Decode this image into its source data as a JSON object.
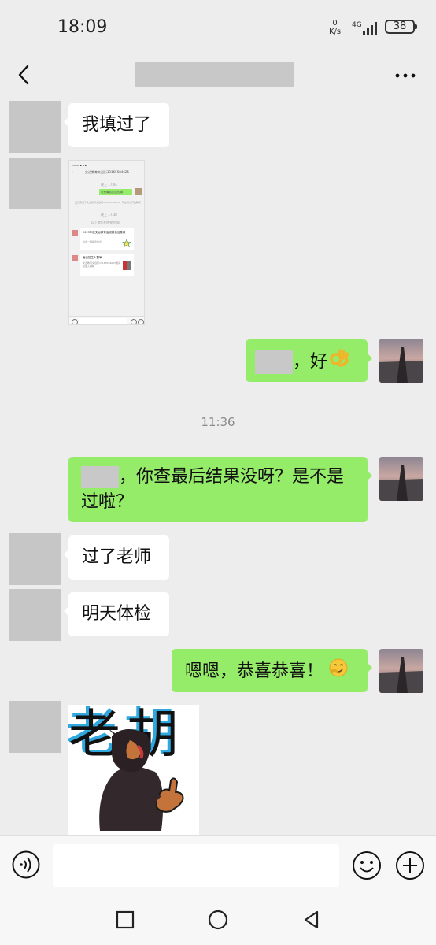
{
  "status_bar": {
    "time": "18:09",
    "net_speed_value": "0",
    "net_speed_unit": "K/s",
    "network": "4G",
    "battery": "38"
  },
  "nav": {
    "back_icon": "chevron-left-icon",
    "more_icon": "more-dots-icon"
  },
  "messages": {
    "m1": {
      "text": "我填过了"
    },
    "m3": {
      "suffix": "，好",
      "emoji": "ok-hand-emoji"
    },
    "timestamp": "11:36",
    "m4": {
      "line1_suffix": "，你查最后结果没呀？是不是",
      "line2": "过啦？"
    },
    "m5": {
      "text": "过了老师"
    },
    "m6": {
      "text": "明天体检"
    },
    "m7": {
      "text": "嗯嗯，恭喜恭喜！",
      "emoji": "smirk-emoji"
    }
  },
  "embedded_screenshot": {
    "header": "文达教育文远衍13165584625",
    "time1": "晚上 17:04",
    "bubble": "老是最后的过的嘛",
    "notice": "您已添加了文达教育文远衍13165584625，现在可以开始聊天了。",
    "time2": "晚上 17:38",
    "tip": "以上是打招呼的内容",
    "card1_title": "2023年度文远教育面试报名信息表",
    "card1_sub": "共享一起填表信息",
    "card2_title": "面谈招生人群审",
    "card2_sub": "文达教育文远衍13165584625邀请您加入群聊"
  },
  "sticker": {
    "text": "老胡"
  },
  "input_bar": {
    "voice_icon": "voice-icon",
    "emoji_icon": "emoji-icon",
    "plus_icon": "plus-icon",
    "placeholder": ""
  },
  "system_nav": {
    "recent": "square-icon",
    "home": "circle-icon",
    "back": "triangle-back-icon"
  }
}
